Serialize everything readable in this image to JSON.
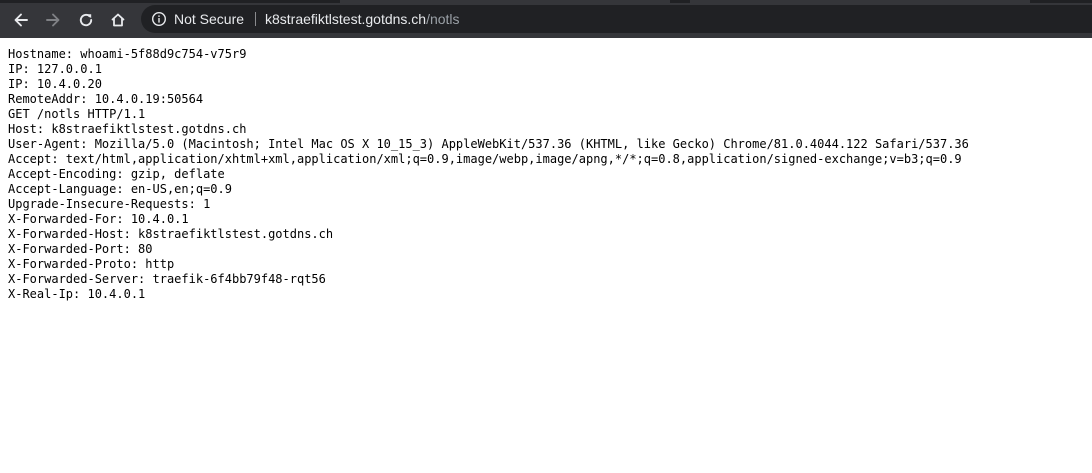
{
  "browser": {
    "security_label": "Not Secure",
    "url_host": "k8straefiktlstest.gotdns.ch",
    "url_path": "/notls"
  },
  "content": {
    "lines": [
      "Hostname: whoami-5f88d9c754-v75r9",
      "IP: 127.0.0.1",
      "IP: 10.4.0.20",
      "RemoteAddr: 10.4.0.19:50564",
      "GET /notls HTTP/1.1",
      "Host: k8straefiktlstest.gotdns.ch",
      "User-Agent: Mozilla/5.0 (Macintosh; Intel Mac OS X 10_15_3) AppleWebKit/537.36 (KHTML, like Gecko) Chrome/81.0.4044.122 Safari/537.36",
      "Accept: text/html,application/xhtml+xml,application/xml;q=0.9,image/webp,image/apng,*/*;q=0.8,application/signed-exchange;v=b3;q=0.9",
      "Accept-Encoding: gzip, deflate",
      "Accept-Language: en-US,en;q=0.9",
      "Upgrade-Insecure-Requests: 1",
      "X-Forwarded-For: 10.4.0.1",
      "X-Forwarded-Host: k8straefiktlstest.gotdns.ch",
      "X-Forwarded-Port: 80",
      "X-Forwarded-Proto: http",
      "X-Forwarded-Server: traefik-6f4bb79f48-rqt56",
      "X-Real-Ip: 10.4.0.1"
    ]
  }
}
